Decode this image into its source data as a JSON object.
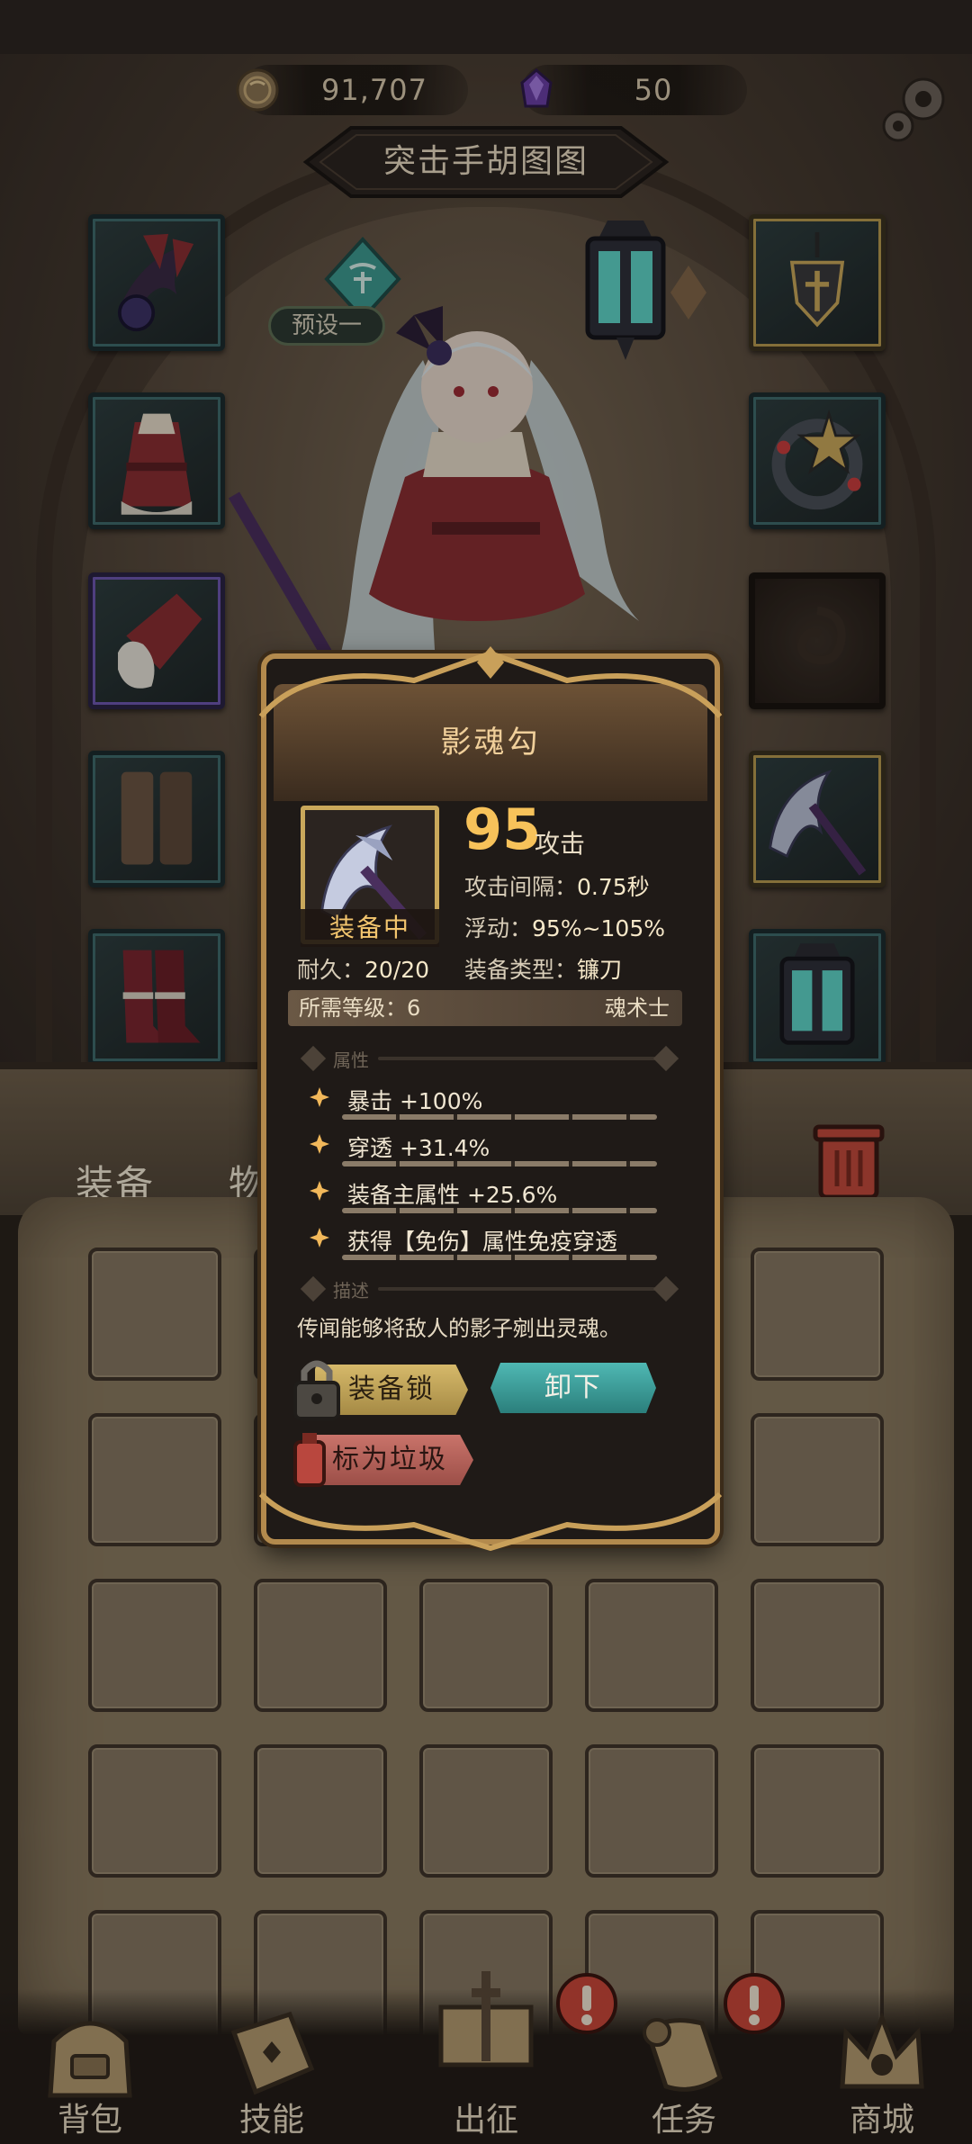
{
  "currency": {
    "gold": "91,707",
    "gems": "50"
  },
  "character": {
    "name": "突击手胡图图",
    "preset": "预设一"
  },
  "tabs": {
    "equipment": "装备",
    "items": "物品"
  },
  "item_popup": {
    "name": "影魂勾",
    "equipped_label": "装备中",
    "attack_value": "95",
    "attack_unit": "攻击",
    "attack_interval_label": "攻击间隔：",
    "attack_interval_value": "0.75秒",
    "float_label": "浮动：",
    "float_value": "95%~105%",
    "durability_label": "耐久：",
    "durability_value": "20/20",
    "type_label": "装备类型：",
    "type_value": "镰刀",
    "level_label": "所需等级：",
    "level_value": "6",
    "class_value": "魂术士",
    "attributes_header": "属性",
    "attributes": [
      "暴击 +100%",
      "穿透 +31.4%",
      "装备主属性 +25.6%",
      "获得【免伤】属性免疫穿透"
    ],
    "description_header": "描述",
    "description": "传闻能够将敌人的影子剜出灵魂。",
    "lock_button": "装备锁",
    "unequip_button": "卸下",
    "mark_trash_button": "标为垃圾"
  },
  "nav": [
    {
      "label": "背包"
    },
    {
      "label": "技能"
    },
    {
      "label": "出征"
    },
    {
      "label": "任务"
    },
    {
      "label": "商城"
    }
  ],
  "colors": {
    "accent_gold": "#f7c25a",
    "teal_button": "#4fb8b3",
    "lock_button": "#d6b96a",
    "trash_button": "#c9736a",
    "popup_border": "#b38a4d"
  }
}
